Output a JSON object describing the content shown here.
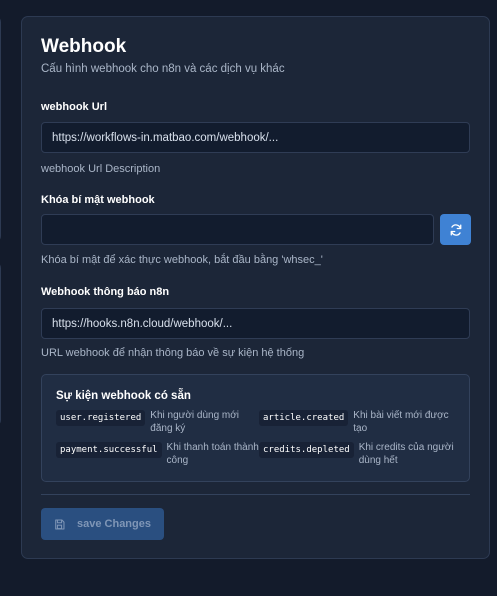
{
  "card": {
    "title": "Webhook",
    "subtitle": "Cấu hình webhook cho n8n và các dịch vụ khác"
  },
  "webhook_url": {
    "label": "webhook Url",
    "value": "https://workflows-in.matbao.com/webhook/...",
    "help": "webhook Url Description"
  },
  "secret": {
    "label": "Khóa bí mật webhook",
    "value": "",
    "help": "Khóa bí mật để xác thực webhook, bắt đầu bằng 'whsec_'",
    "refresh_icon": "refresh-icon"
  },
  "notify_url": {
    "label": "Webhook thông báo n8n",
    "value": "https://hooks.n8n.cloud/webhook/...",
    "help": "URL webhook để nhận thông báo về sự kiện hệ thống"
  },
  "events": {
    "title": "Sự kiện webhook có sẵn",
    "items": [
      {
        "code": "user.registered",
        "desc_lines": [
          "Khi người dùng mới",
          "đăng ký"
        ]
      },
      {
        "code": "article.created",
        "desc_lines": [
          "Khi bài viết mới được",
          "tạo"
        ]
      },
      {
        "code": "payment.successful",
        "desc_lines": [
          "Khi thanh toán thành",
          "công"
        ]
      },
      {
        "code": "credits.depleted",
        "desc_lines": [
          "Khi credits của người",
          "dùng hết"
        ]
      }
    ]
  },
  "save": {
    "label": "save Changes",
    "icon": "save-icon"
  },
  "colors": {
    "background": "#131b2b",
    "card": "#1c2638",
    "accent": "#3f82d4",
    "save_disabled": "#2a4f80"
  }
}
